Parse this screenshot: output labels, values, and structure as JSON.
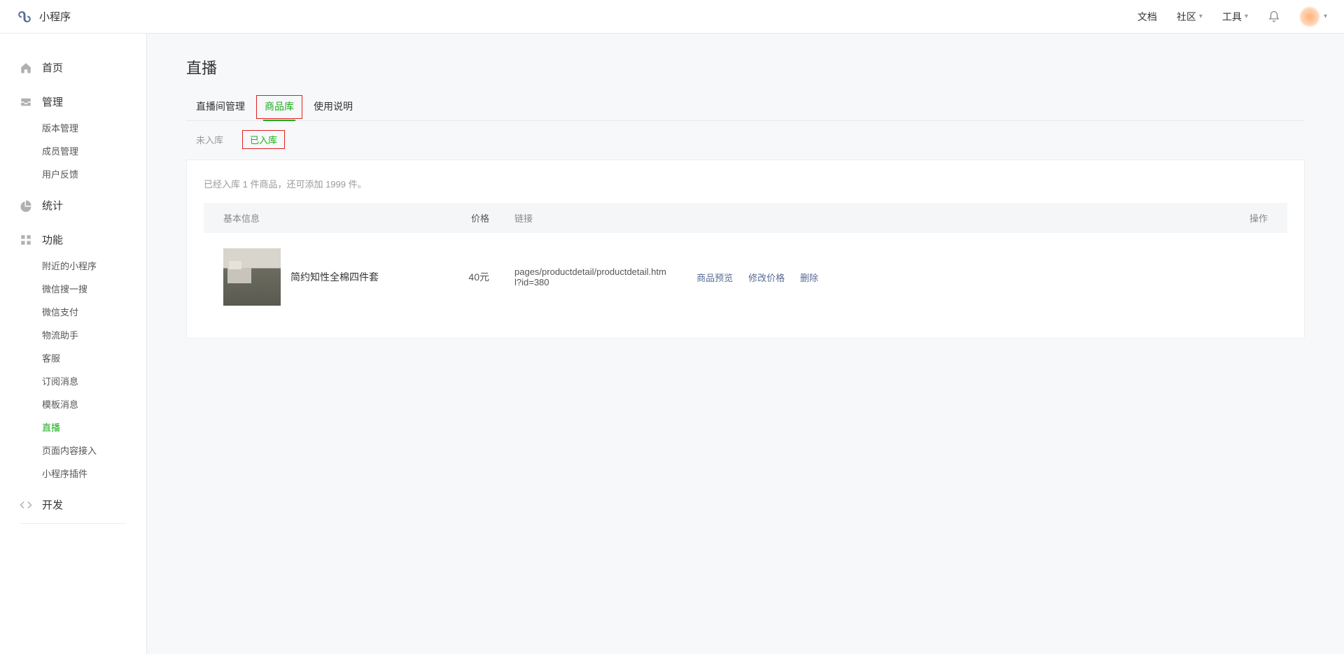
{
  "header": {
    "app_name": "小程序",
    "nav": [
      {
        "label": "文档",
        "dropdown": false
      },
      {
        "label": "社区",
        "dropdown": true
      },
      {
        "label": "工具",
        "dropdown": true
      }
    ]
  },
  "sidebar": {
    "groups": [
      {
        "icon": "home",
        "label": "首页",
        "items": []
      },
      {
        "icon": "inbox",
        "label": "管理",
        "items": [
          "版本管理",
          "成员管理",
          "用户反馈"
        ]
      },
      {
        "icon": "pie",
        "label": "统计",
        "items": []
      },
      {
        "icon": "grid",
        "label": "功能",
        "items": [
          "附近的小程序",
          "微信搜一搜",
          "微信支付",
          "物流助手",
          "客服",
          "订阅消息",
          "模板消息",
          "直播",
          "页面内容接入",
          "小程序插件"
        ],
        "active_item": "直播"
      },
      {
        "icon": "code",
        "label": "开发",
        "items": []
      }
    ]
  },
  "page": {
    "title": "直播",
    "tabs": [
      "直播间管理",
      "商品库",
      "使用说明"
    ],
    "active_tab": "商品库",
    "subtabs": [
      "未入库",
      "已入库"
    ],
    "active_subtab": "已入库",
    "hint": "已经入库 1 件商品，还可添加 1999 件。",
    "columns": {
      "info": "基本信息",
      "price": "价格",
      "link": "链接",
      "actions": "操作"
    },
    "rows": [
      {
        "name": "简约知性全棉四件套",
        "price": "40元",
        "link": "pages/productdetail/productdetail.html?id=380",
        "actions": [
          "商品预览",
          "修改价格",
          "删除"
        ]
      }
    ]
  }
}
